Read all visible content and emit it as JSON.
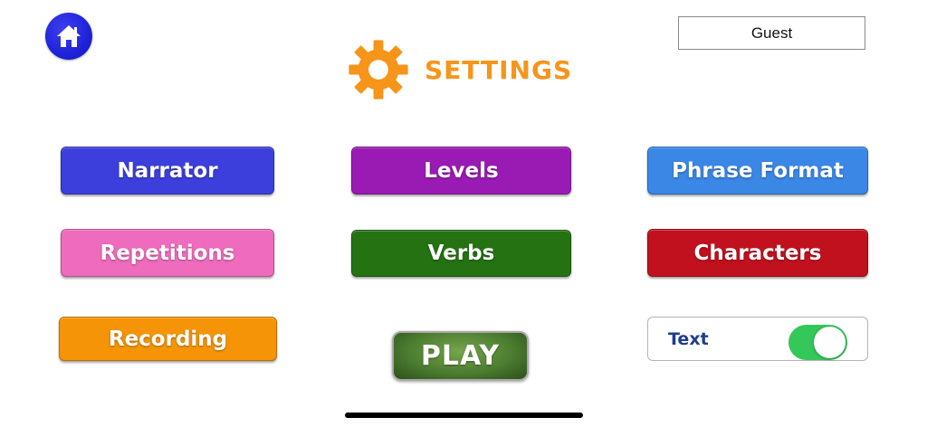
{
  "header": {
    "title": "SETTINGS",
    "user_name": "Guest",
    "home_icon": "home-icon",
    "settings_icon": "gear-icon"
  },
  "menu": {
    "narrator": "Narrator",
    "levels": "Levels",
    "phrase_format": "Phrase Format",
    "repetitions": "Repetitions",
    "verbs": "Verbs",
    "characters": "Characters",
    "recording": "Recording"
  },
  "play": {
    "label": "PLAY"
  },
  "text_toggle": {
    "label": "Text",
    "enabled": true
  },
  "colors": {
    "title": "#f6951a",
    "narrator": "#3c3fdc",
    "levels": "#9a1bb3",
    "phrase_format": "#3a87e6",
    "repetitions": "#ee6bbd",
    "verbs": "#257213",
    "characters": "#c1111f",
    "recording": "#f49406",
    "toggle_on": "#34c759",
    "home_button": "#1f23d8"
  }
}
